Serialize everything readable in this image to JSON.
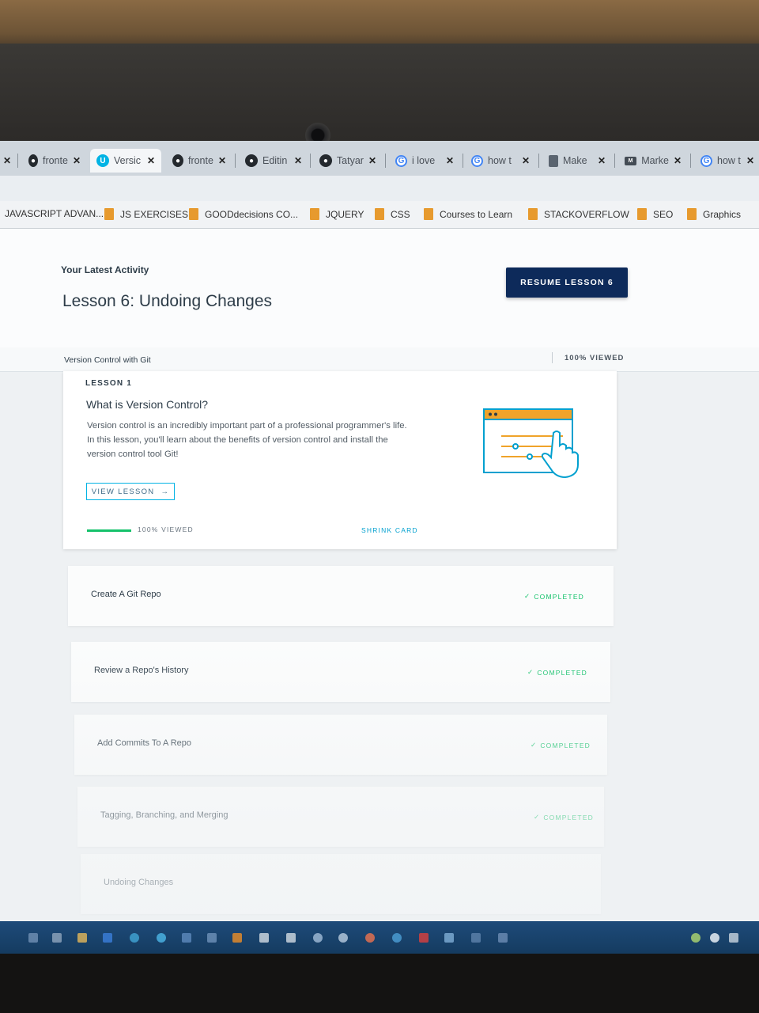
{
  "browser": {
    "tabs": [
      {
        "label": "fronte",
        "icon": "github-icon",
        "active": false
      },
      {
        "label": "Versic",
        "icon": "udacity-icon",
        "active": true
      },
      {
        "label": "fronte",
        "icon": "github-icon",
        "active": false
      },
      {
        "label": "Editin",
        "icon": "github-icon",
        "active": false
      },
      {
        "label": "Tatyar",
        "icon": "github-icon",
        "active": false
      },
      {
        "label": "i love",
        "icon": "google-icon",
        "active": false
      },
      {
        "label": "how t",
        "icon": "google-icon",
        "active": false
      },
      {
        "label": "Make",
        "icon": "document-icon",
        "active": false
      },
      {
        "label": "Marke",
        "icon": "markdown-icon",
        "active": false
      },
      {
        "label": "how t",
        "icon": "google-icon",
        "active": false
      }
    ],
    "close_glyph": "✕",
    "bookmarks": [
      {
        "label": "JAVASCRIPT ADVAN..."
      },
      {
        "label": "JS EXERCISES"
      },
      {
        "label": "GOODdecisions CO..."
      },
      {
        "label": "JQUERY"
      },
      {
        "label": "CSS"
      },
      {
        "label": "Courses to Learn"
      },
      {
        "label": "STACKOVERFLOW"
      },
      {
        "label": "SEO"
      },
      {
        "label": "Graphics"
      }
    ]
  },
  "activity": {
    "label": "Your Latest Activity",
    "title": "Lesson 6: Undoing Changes",
    "resume_button": "RESUME LESSON 6"
  },
  "course": {
    "name": "Version Control with Git",
    "viewed": "100% VIEWED"
  },
  "lesson_card": {
    "number": "LESSON 1",
    "title": "What is Version Control?",
    "description": "Version control is an incredibly important part of a professional programmer's life. In this lesson, you'll learn about the benefits of version control and install the version control tool Git!",
    "view_button": "VIEW LESSON",
    "progress": 1.0,
    "progress_label": "100% VIEWED",
    "shrink": "SHRINK CARD"
  },
  "lessons": [
    {
      "title": "Create A Git Repo",
      "status": "COMPLETED"
    },
    {
      "title": "Review a Repo's History",
      "status": "COMPLETED"
    },
    {
      "title": "Add Commits To A Repo",
      "status": "COMPLETED"
    },
    {
      "title": "Tagging, Branching, and Merging",
      "status": "COMPLETED"
    },
    {
      "title": "Undoing Changes",
      "status": ""
    }
  ],
  "colors": {
    "accent": "#02b3e4",
    "primary_button": "#0d2a5a",
    "completed": "#15c26b",
    "illustration_bar": "#f0a32a"
  }
}
